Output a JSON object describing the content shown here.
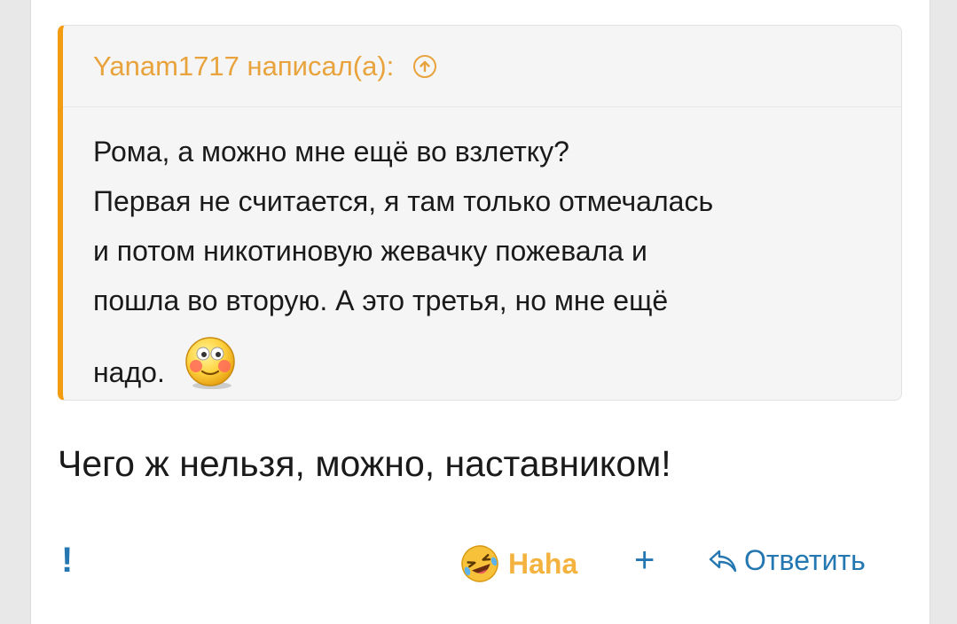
{
  "quote": {
    "author": "Yanam1717 написал(а):",
    "lines": [
      "Рома, а можно мне ещё во взлетку?",
      "Первая не считается, я там только отмечалась",
      "и потом никотиновую жевачку пожевала и",
      "пошла во вторую. А это третья, но мне ещё",
      "надо."
    ],
    "smiley": "blushing-smiley"
  },
  "reply": {
    "text": "Чего ж нельзя, можно, наставником!"
  },
  "footer": {
    "report_glyph": "!",
    "reaction_label": "Haha",
    "add_reaction_glyph": "+",
    "reply_label": "Ответить"
  },
  "colors": {
    "accent_orange": "#f39c12",
    "link_blue": "#2577b1",
    "reaction_gold": "#f4b33f"
  }
}
